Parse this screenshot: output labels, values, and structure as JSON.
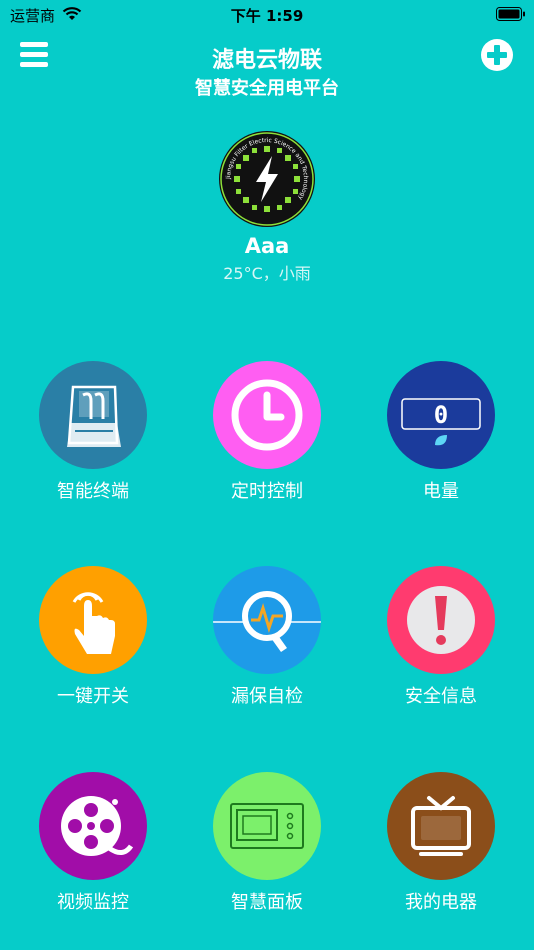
{
  "status_bar": {
    "carrier": "运营商",
    "time": "下午 1:59"
  },
  "header": {
    "title": "滤电云物联",
    "subtitle": "智慧安全用电平台",
    "menu_icon": "hamburger-menu-icon",
    "add_icon": "plus-circle-icon"
  },
  "profile": {
    "name": "Aaa",
    "weather": "25°C，小雨",
    "logo_ring_text": "Jiangsu Filter Electric Science and Technology"
  },
  "grid": [
    {
      "label": "智能终端",
      "icon": "distribution-box-icon",
      "color": "#2A7FA6"
    },
    {
      "label": "定时控制",
      "icon": "clock-icon",
      "color": "#FF5EF2"
    },
    {
      "label": "电量",
      "icon": "meter-display-icon",
      "color": "#1B3B9C",
      "meter_value": "0"
    },
    {
      "label": "一键开关",
      "icon": "finger-tap-icon",
      "color": "#FFA000"
    },
    {
      "label": "漏保自检",
      "icon": "magnifier-wave-icon",
      "color": "#1E9BE8"
    },
    {
      "label": "安全信息",
      "icon": "exclamation-icon",
      "color": "#FF3B6F"
    },
    {
      "label": "视频监控",
      "icon": "film-reel-icon",
      "color": "#A10DA8"
    },
    {
      "label": "智慧面板",
      "icon": "smart-panel-icon",
      "color": "#7CF06B"
    },
    {
      "label": "我的电器",
      "icon": "tv-icon",
      "color": "#8B4E1A"
    }
  ]
}
